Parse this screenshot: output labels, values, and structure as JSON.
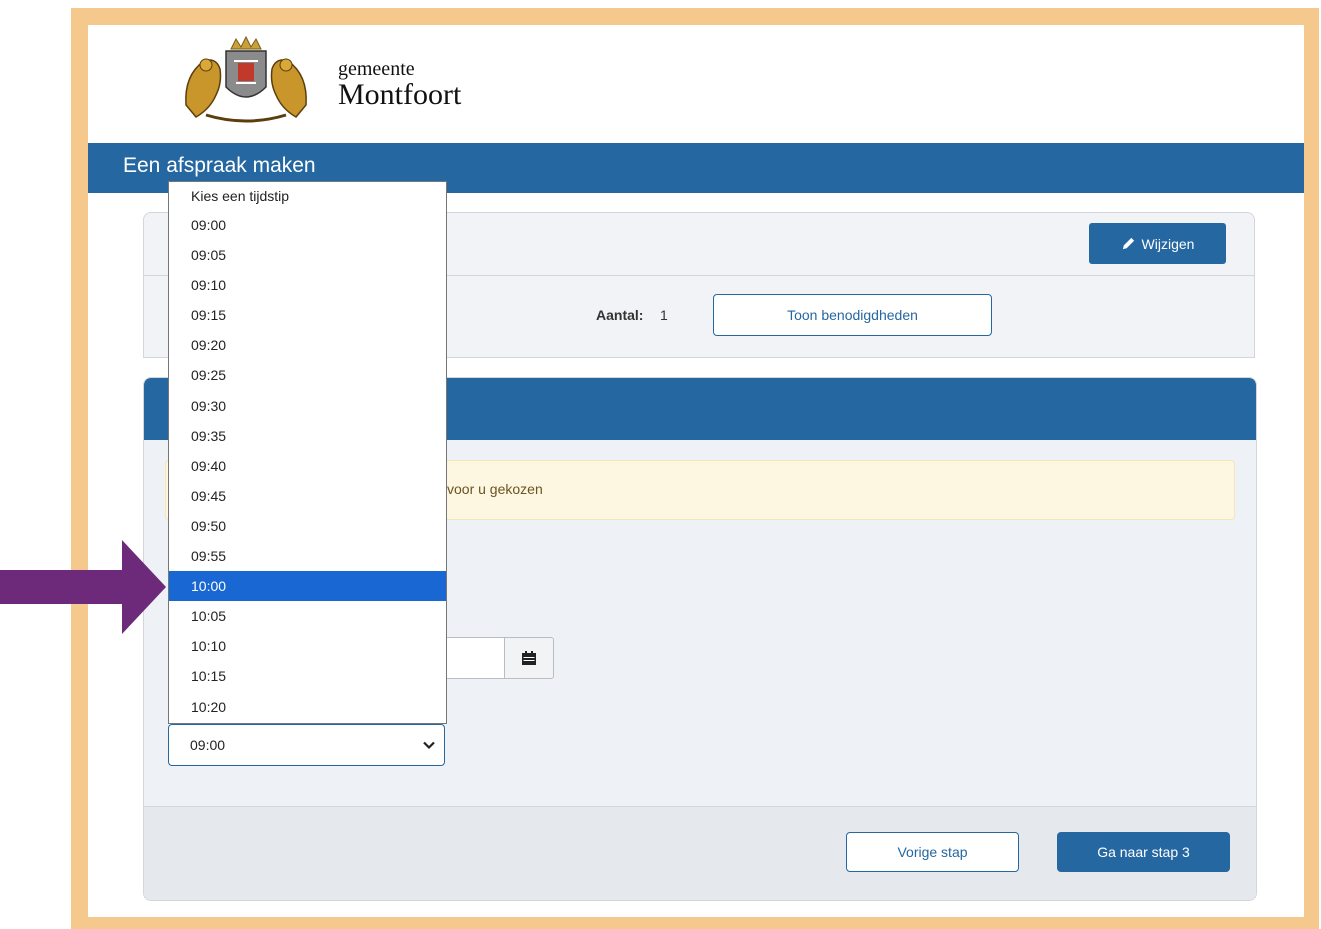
{
  "header": {
    "logo_small": "gemeente",
    "logo_big": "Montfoort",
    "page_title": "Een afspraak maken"
  },
  "summary": {
    "edit_label": "Wijzigen",
    "aantal_label": "Aantal:",
    "aantal_value": "1",
    "toon_label": "Toon benodigdheden"
  },
  "card": {
    "alert_text": "voor u gekozen",
    "time_select_value": "09:00"
  },
  "footer": {
    "prev_label": "Vorige stap",
    "next_label": "Ga naar stap 3"
  },
  "dropdown": {
    "placeholder": "Kies een tijdstip",
    "options": [
      "09:00",
      "09:05",
      "09:10",
      "09:15",
      "09:20",
      "09:25",
      "09:30",
      "09:35",
      "09:40",
      "09:45",
      "09:50",
      "09:55",
      "10:00",
      "10:05",
      "10:10",
      "10:15",
      "10:20"
    ],
    "highlighted": "10:00"
  },
  "colors": {
    "brand_blue": "#2567a0",
    "frame_orange": "#f5c88e",
    "highlight_blue": "#1967d2",
    "arrow_purple": "#6d2a7a"
  },
  "icons": [
    "crest-logo",
    "pencil-icon",
    "calendar-icon",
    "chevron-down-icon",
    "arrow-right-icon"
  ]
}
